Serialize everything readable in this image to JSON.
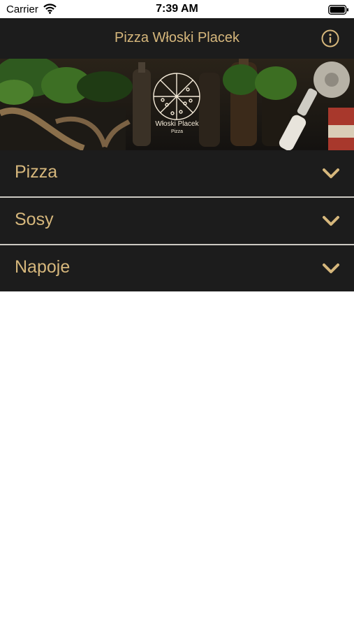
{
  "status_bar": {
    "carrier": "Carrier",
    "time": "7:39 AM"
  },
  "header": {
    "title": "Pizza Włoski Placek",
    "info_icon": "info-icon"
  },
  "banner": {
    "logo_name": "Włoski Placek",
    "logo_subtitle": "Pizza"
  },
  "menu": {
    "categories": [
      {
        "label": "Pizza",
        "icon": "chevron-down-icon"
      },
      {
        "label": "Sosy",
        "icon": "chevron-down-icon"
      },
      {
        "label": "Napoje",
        "icon": "chevron-down-icon"
      }
    ]
  },
  "colors": {
    "accent": "#d6b77c",
    "bar_background": "#1c1c1c",
    "divider": "#ccc9c2",
    "page_background": "#ffffff"
  }
}
